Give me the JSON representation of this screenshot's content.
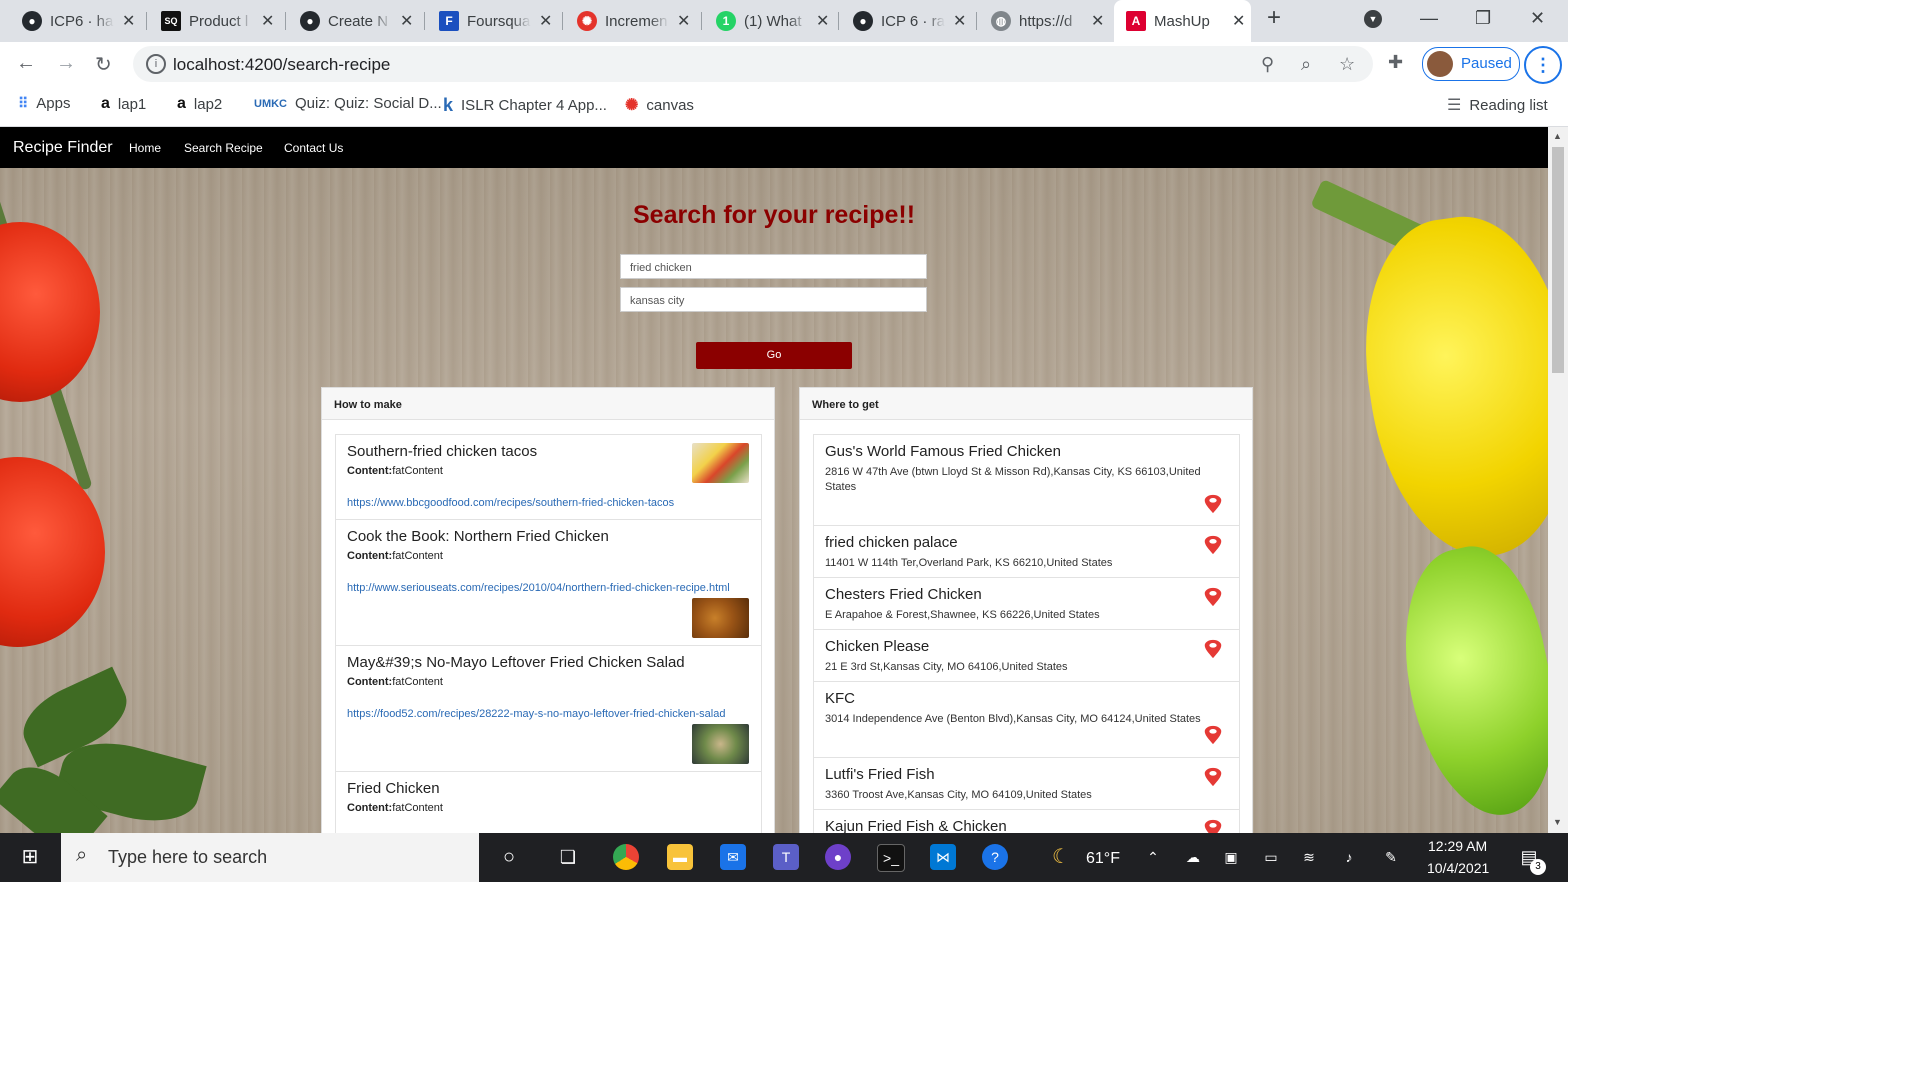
{
  "browser": {
    "tabs": [
      {
        "title": "ICP6 · ha",
        "icon": "github-icon"
      },
      {
        "title": "Product l",
        "icon": "sq-icon"
      },
      {
        "title": "Create N",
        "icon": "github-icon"
      },
      {
        "title": "Foursqua",
        "icon": "foursquare-icon"
      },
      {
        "title": "Incremen",
        "icon": "canvas-icon"
      },
      {
        "title": "(1) What",
        "icon": "whatsapp-icon"
      },
      {
        "title": "ICP 6 · ra",
        "icon": "github-icon"
      },
      {
        "title": "https://d",
        "icon": "globe-icon"
      },
      {
        "title": "MashUp",
        "icon": "angular-icon"
      }
    ],
    "url": "localhost:4200/search-recipe",
    "profile_label": "Paused",
    "bookmarks": [
      {
        "label": "Apps"
      },
      {
        "label": "lap1"
      },
      {
        "label": "lap2"
      },
      {
        "label": "Quiz: Quiz: Social D..."
      },
      {
        "label": "ISLR Chapter 4 App..."
      },
      {
        "label": "canvas"
      }
    ],
    "reading_list": "Reading list"
  },
  "navbar": {
    "brand": "Recipe Finder",
    "links": [
      "Home",
      "Search Recipe",
      "Contact Us"
    ]
  },
  "search": {
    "heading": "Search for your recipe!!",
    "recipe_value": "fried chicken",
    "location_value": "kansas city",
    "go_label": "Go"
  },
  "how_to_make": {
    "title": "How to make",
    "content_label": "Content:",
    "items": [
      {
        "name": "Southern-fried chicken tacos",
        "content": "fatContent",
        "link": "https://www.bbcgoodfood.com/recipes/southern-fried-chicken-tacos"
      },
      {
        "name": "Cook the Book: Northern Fried Chicken",
        "content": "fatContent",
        "link": "http://www.seriouseats.com/recipes/2010/04/northern-fried-chicken-recipe.html"
      },
      {
        "name": "May&#39;s No-Mayo Leftover Fried Chicken Salad",
        "content": "fatContent",
        "link": "https://food52.com/recipes/28222-may-s-no-mayo-leftover-fried-chicken-salad"
      },
      {
        "name": "Fried Chicken",
        "content": "fatContent"
      }
    ]
  },
  "where_to_get": {
    "title": "Where to get",
    "items": [
      {
        "name": "Gus's World Famous Fried Chicken",
        "address": "2816 W 47th Ave (btwn Lloyd St & Misson Rd),Kansas City, KS 66103,United States"
      },
      {
        "name": "fried chicken palace",
        "address": "11401 W 114th Ter,Overland Park, KS 66210,United States"
      },
      {
        "name": "Chesters Fried Chicken",
        "address": "E Arapahoe & Forest,Shawnee, KS 66226,United States"
      },
      {
        "name": "Chicken Please",
        "address": "21 E 3rd St,Kansas City, MO 64106,United States"
      },
      {
        "name": "KFC",
        "address": "3014 Independence Ave (Benton Blvd),Kansas City, MO 64124,United States"
      },
      {
        "name": "Lutfi's Fried Fish",
        "address": "3360 Troost Ave,Kansas City, MO 64109,United States"
      },
      {
        "name": "Kajun Fried Fish & Chicken",
        "address": ""
      }
    ]
  },
  "taskbar": {
    "search_placeholder": "Type here to search",
    "temperature": "61°F",
    "time": "12:29 AM",
    "date": "10/4/2021",
    "notification_count": "3"
  },
  "colors": {
    "accent": "#8b0000",
    "link": "#2a6ab5",
    "pin": "#e53935"
  }
}
